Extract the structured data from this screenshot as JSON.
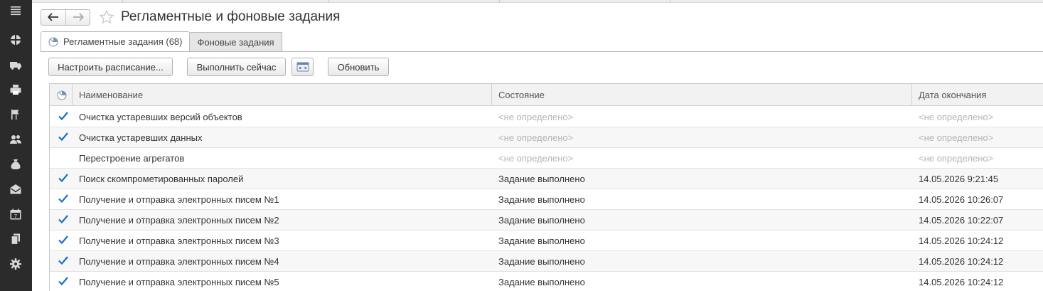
{
  "sidebar": {
    "icons": [
      "menu-icon",
      "desktop-icon",
      "truck-icon",
      "printer-icon",
      "flags-icon",
      "users-icon",
      "money-bag-icon",
      "mail-icon",
      "calendar-icon",
      "documents-icon",
      "gear-icon"
    ]
  },
  "header": {
    "title": "Регламентные и фоновые задания"
  },
  "tabs": [
    {
      "label": "Регламентные задания (68)",
      "active": true
    },
    {
      "label": "Фоновые задания",
      "active": false
    }
  ],
  "toolbar": {
    "schedule_label": "Настроить расписание...",
    "run_now_label": "Выполнить сейчас",
    "refresh_label": "Обновить"
  },
  "table": {
    "columns": [
      "Наименование",
      "Состояние",
      "Дата окончания"
    ],
    "rows": [
      {
        "checked": true,
        "name": "Очистка устаревших версий объектов",
        "state": "<не определено>",
        "end": "<не определено>",
        "muted": true
      },
      {
        "checked": true,
        "name": "Очистка устаревших данных",
        "state": "<не определено>",
        "end": "<не определено>",
        "muted": true
      },
      {
        "checked": false,
        "name": "Перестроение агрегатов",
        "state": "<не определено>",
        "end": "<не определено>",
        "muted": true
      },
      {
        "checked": true,
        "name": "Поиск скомпрометированных паролей",
        "state": "Задание выполнено",
        "end": "14.05.2026 9:21:45",
        "muted": false
      },
      {
        "checked": true,
        "name": "Получение и отправка электронных писем №1",
        "state": "Задание выполнено",
        "end": "14.05.2026 10:26:07",
        "muted": false
      },
      {
        "checked": true,
        "name": "Получение и отправка электронных писем №2",
        "state": "Задание выполнено",
        "end": "14.05.2026 10:22:07",
        "muted": false
      },
      {
        "checked": true,
        "name": "Получение и отправка электронных писем №3",
        "state": "Задание выполнено",
        "end": "14.05.2026 10:24:12",
        "muted": false
      },
      {
        "checked": true,
        "name": "Получение и отправка электронных писем №4",
        "state": "Задание выполнено",
        "end": "14.05.2026 10:24:12",
        "muted": false
      },
      {
        "checked": true,
        "name": "Получение и отправка электронных писем №5",
        "state": "Задание выполнено",
        "end": "14.05.2026 10:24:12",
        "muted": false
      }
    ]
  },
  "colors": {
    "check": "#1a6fc4",
    "sidebar_bg": "#2b2b2b"
  }
}
